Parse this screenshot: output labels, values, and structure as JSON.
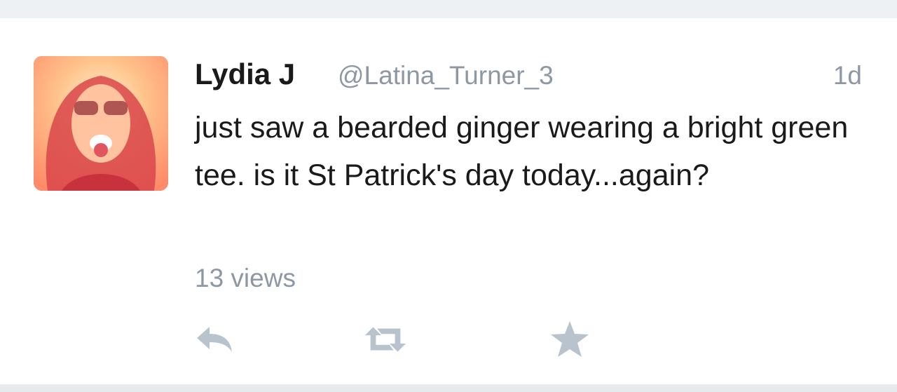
{
  "tweet": {
    "author_name": "Lydia J",
    "handle": "@Latina_Turner_3",
    "time": "1d",
    "text": "just saw a bearded ginger wearing a bright green tee. is it St Patrick's day today...again?",
    "views": "13 views"
  },
  "actions": {
    "reply_icon": "reply-icon",
    "retweet_icon": "retweet-icon",
    "favorite_icon": "star-icon"
  },
  "colors": {
    "icon_gray": "#b8c3cd",
    "secondary_text": "#8d98a4",
    "primary_text": "#1a1a1a"
  }
}
